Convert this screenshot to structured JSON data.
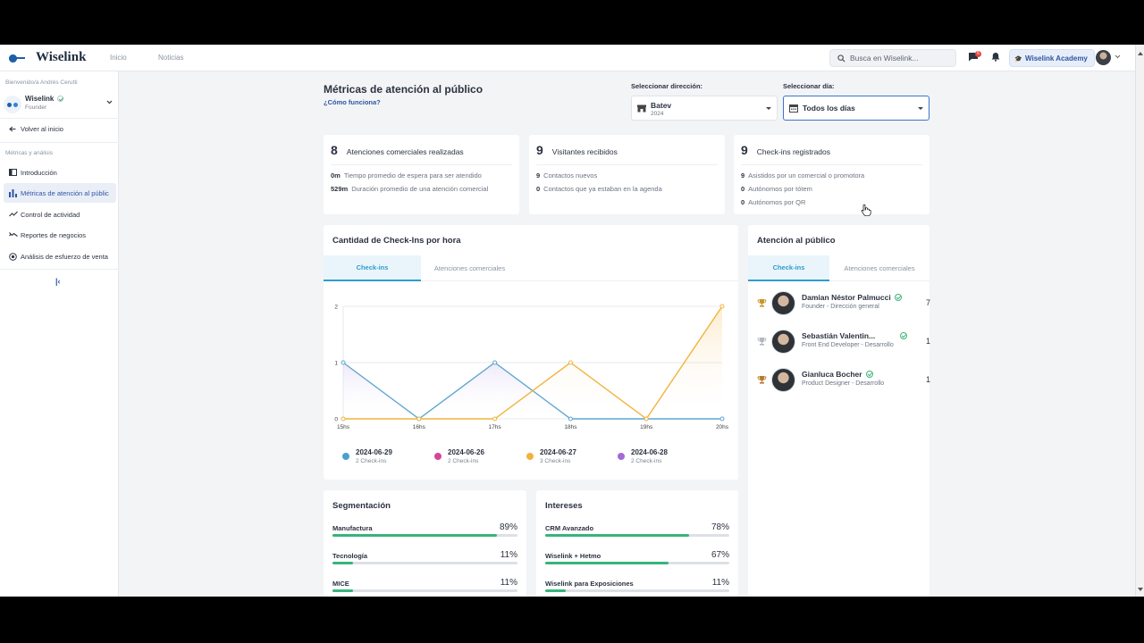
{
  "app": {
    "logo_text": "Wiselink"
  },
  "topnav": {
    "items": [
      "Inicio",
      "Noticias"
    ]
  },
  "search": {
    "placeholder": "Busca en Wiselink..."
  },
  "notifications": {
    "messages_badge": "6"
  },
  "academy": {
    "label": "Wiselink Academy"
  },
  "sidebar": {
    "welcome": "Bienvenido/a Andrés Cerutti",
    "org_name": "Wiselink",
    "org_role": "Founder",
    "back_label": "Volver al inicio",
    "section_label": "Métricas y análisis",
    "items": [
      {
        "label": "Introducción",
        "icon": "book-icon"
      },
      {
        "label": "Métricas de atención al públic",
        "icon": "bar-chart-icon",
        "active": true
      },
      {
        "label": "Control de actividad",
        "icon": "trend-icon"
      },
      {
        "label": "Reportes de negocios",
        "icon": "zigzag-icon"
      },
      {
        "label": "Análisis de esfuerzo de venta",
        "icon": "target-icon"
      }
    ],
    "collapse_label": "|‹"
  },
  "page": {
    "title": "Métricas de atención al público",
    "help_link": "¿Cómo funciona?"
  },
  "filters": {
    "address_label": "Seleccionar dirección:",
    "address_value": "Batev",
    "address_sub": "2024",
    "day_label": "Seleccionar día:",
    "day_value": "Todos los días"
  },
  "stats": [
    {
      "value": "8",
      "title": "Atenciones comerciales realizadas",
      "rows": [
        {
          "value": "0m",
          "text": "Tiempo promedio de espera para ser atendido"
        },
        {
          "value": "529m",
          "text": "Duración promedio de una atención comercial"
        }
      ]
    },
    {
      "value": "9",
      "title": "Visitantes recibidos",
      "rows": [
        {
          "value": "9",
          "text": "Contactos nuevos"
        },
        {
          "value": "0",
          "text": "Contactos que ya estaban en la agenda"
        }
      ]
    },
    {
      "value": "9",
      "title": "Check-ins registrados",
      "rows": [
        {
          "value": "9",
          "text": "Asistidos por un comercial o promotora"
        },
        {
          "value": "0",
          "text": "Autónomos por tótem"
        },
        {
          "value": "0",
          "text": "Autónomos por QR"
        }
      ]
    }
  ],
  "checkins_card": {
    "title": "Cantidad de Check-Ins por hora",
    "tabs": [
      "Check-ins",
      "Atenciones comerciales"
    ],
    "legend": [
      {
        "date": "2024-06-29",
        "sub": "2 Check-ins",
        "color": "#4a9fd0"
      },
      {
        "date": "2024-06-26",
        "sub": "2 Check-ins",
        "color": "#d6449b"
      },
      {
        "date": "2024-06-27",
        "sub": "3 Check-ins",
        "color": "#f1b33c"
      },
      {
        "date": "2024-06-28",
        "sub": "2 Check-ins",
        "color": "#a26ad6"
      }
    ]
  },
  "chart_data": {
    "type": "line",
    "title": "",
    "x": [
      "15hs",
      "16hs",
      "17hs",
      "18hs",
      "19hs",
      "20hs"
    ],
    "ylim": [
      0,
      2
    ],
    "yticks": [
      "0",
      "1",
      "2"
    ],
    "series": [
      {
        "name": "2024-06-29",
        "color": "#5fa6cf",
        "values": [
          1,
          0,
          1,
          0,
          0,
          0
        ]
      },
      {
        "name": "2024-06-27",
        "color": "#f1b33c",
        "values": [
          0,
          0,
          0,
          1,
          0,
          2
        ]
      }
    ],
    "grid": true
  },
  "attention_card": {
    "title": "Atención al público",
    "tabs": [
      "Check-ins",
      "Atenciones comerciales"
    ],
    "ranking": [
      {
        "name": "Damian Néstor Palmucci",
        "role": "Founder - Dirección general",
        "count": "7",
        "trophy_color": "#c9962a"
      },
      {
        "name": "Sebastián Valentin...",
        "role": "Front End Developer - Desarrollo",
        "count": "1",
        "trophy_color": "#b3b8bf"
      },
      {
        "name": "Gianluca Bocher",
        "role": "Product Designer - Desarrollo",
        "count": "1",
        "trophy_color": "#b87a2f"
      }
    ]
  },
  "segmentation": {
    "title": "Segmentación",
    "rows": [
      {
        "label": "Manufactura",
        "pct": "89%",
        "value": 0.89
      },
      {
        "label": "Tecnología",
        "pct": "11%",
        "value": 0.11
      },
      {
        "label": "MICE",
        "pct": "11%",
        "value": 0.11
      }
    ]
  },
  "interests": {
    "title": "Intereses",
    "rows": [
      {
        "label": "CRM Avanzado",
        "pct": "78%",
        "value": 0.78
      },
      {
        "label": "Wiselink + Hetmo",
        "pct": "67%",
        "value": 0.67
      },
      {
        "label": "Wiselink para Exposiciones",
        "pct": "11%",
        "value": 0.11
      }
    ]
  }
}
